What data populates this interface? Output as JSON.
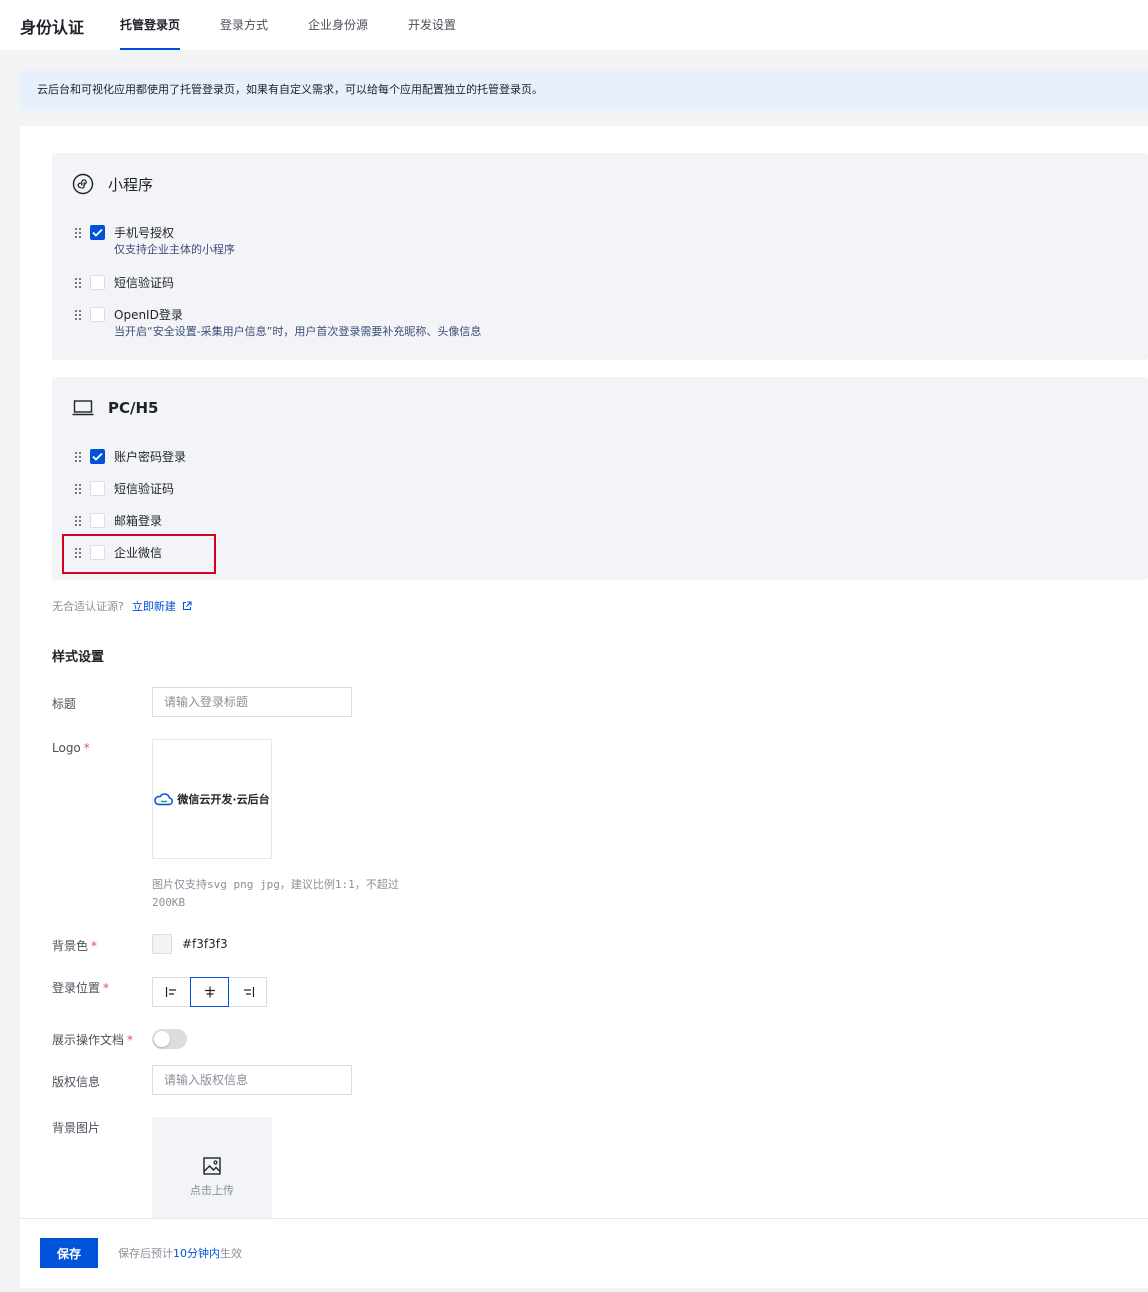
{
  "header": {
    "title": "身份认证",
    "tabs": [
      {
        "label": "托管登录页",
        "active": true
      },
      {
        "label": "登录方式",
        "active": false
      },
      {
        "label": "企业身份源",
        "active": false
      },
      {
        "label": "开发设置",
        "active": false
      }
    ]
  },
  "banner": {
    "text": "云后台和可视化应用都使用了托管登录页，如果有自定义需求，可以给每个应用配置独立的托管登录页。"
  },
  "groups": {
    "miniprogram": {
      "title": "小程序",
      "icon": "miniprogram-icon",
      "options": [
        {
          "label": "手机号授权",
          "desc": "仅支持企业主体的小程序",
          "checked": true
        },
        {
          "label": "短信验证码",
          "desc": "",
          "checked": false
        },
        {
          "label": "OpenID登录",
          "desc": "当开启“安全设置-采集用户信息”时，用户首次登录需要补充昵称、头像信息",
          "checked": false
        }
      ]
    },
    "pc": {
      "title": "PC/H5",
      "icon": "laptop-icon",
      "options": [
        {
          "label": "账户密码登录",
          "checked": true
        },
        {
          "label": "短信验证码",
          "checked": false
        },
        {
          "label": "邮箱登录",
          "checked": false
        },
        {
          "label": "企业微信",
          "checked": false
        }
      ]
    }
  },
  "hint": {
    "text": "无合适认证源?",
    "link": "立即新建"
  },
  "style_settings": {
    "section_title": "样式设置",
    "title_field": {
      "label": "标题",
      "placeholder": "请输入登录标题",
      "value": ""
    },
    "logo": {
      "label": "Logo",
      "brand_text": "微信云开发·云后台",
      "tip_line1": "图片仅支持svg png jpg，建议比例1:1，不超过",
      "tip_line2": "200KB"
    },
    "bg_color": {
      "label": "背景色",
      "value": "#f3f3f3"
    },
    "login_position": {
      "label": "登录位置",
      "options": [
        "left",
        "center",
        "right"
      ],
      "selected": "center"
    },
    "show_docs": {
      "label": "展示操作文档",
      "enabled": false
    },
    "copyright": {
      "label": "版权信息",
      "placeholder": "请输入版权信息",
      "value": ""
    },
    "bg_image": {
      "label": "背景图片",
      "upload_text": "点击上传"
    }
  },
  "footer": {
    "save_label": "保存",
    "note_prefix": "保存后预计",
    "note_emphasis": "10分钟内",
    "note_suffix": "生效"
  },
  "colors": {
    "primary": "#0052d9",
    "banner_bg": "#e8f0fd",
    "highlight_border": "#d9001b",
    "required": "#e34d59"
  }
}
